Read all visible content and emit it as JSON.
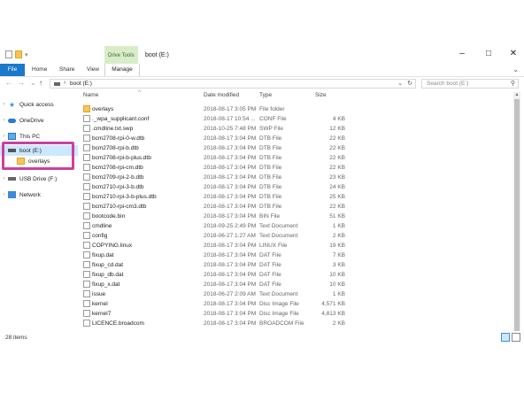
{
  "window": {
    "title": "boot (E:)",
    "context_tab_group": "Drive Tools",
    "controls": {
      "minimize": "–",
      "maximize": "□",
      "close": "✕"
    }
  },
  "ribbon": {
    "tabs": [
      {
        "label": "File"
      },
      {
        "label": "Home"
      },
      {
        "label": "Share"
      },
      {
        "label": "View"
      },
      {
        "label": "Manage"
      }
    ]
  },
  "navigation": {
    "back": "←",
    "forward": "→",
    "recent": "⌄",
    "up": "↑",
    "address_path": "boot (E:)",
    "search_placeholder": "Search boot (E:)"
  },
  "sidebar": {
    "items": [
      {
        "label": "Quick access",
        "icon": "star-icon"
      },
      {
        "label": "OneDrive",
        "icon": "cloud-icon"
      },
      {
        "label": "This PC",
        "icon": "computer-icon"
      },
      {
        "label": "boot (E:)",
        "icon": "drive-icon",
        "selected": true
      },
      {
        "label": "overlays",
        "icon": "folder-icon"
      },
      {
        "label": "USB Drive (F:)",
        "icon": "usb-drive-icon"
      },
      {
        "label": "Network",
        "icon": "network-icon"
      }
    ]
  },
  "columns": {
    "name": "Name",
    "date": "Date modified",
    "type": "Type",
    "size": "Size"
  },
  "files": [
    {
      "name": "overlays",
      "date": "2018-08-17 3:05 PM",
      "type": "File folder",
      "size": "",
      "icon": "folder"
    },
    {
      "name": "._wpa_supplicant.conf",
      "date": "2018-08-17 10:54 ...",
      "type": "CONF File",
      "size": "4 KB",
      "icon": "file"
    },
    {
      "name": ".cmdline.txt.swp",
      "date": "2018-10-25 7:48 PM",
      "type": "SWP File",
      "size": "12 KB",
      "icon": "file"
    },
    {
      "name": "bcm2708-rpi-0-w.dtb",
      "date": "2018-08-17 3:04 PM",
      "type": "DTB File",
      "size": "22 KB",
      "icon": "file"
    },
    {
      "name": "bcm2708-rpi-b.dtb",
      "date": "2018-08-17 3:04 PM",
      "type": "DTB File",
      "size": "22 KB",
      "icon": "file"
    },
    {
      "name": "bcm2708-rpi-b-plus.dtb",
      "date": "2018-08-17 3:04 PM",
      "type": "DTB File",
      "size": "22 KB",
      "icon": "file"
    },
    {
      "name": "bcm2708-rpi-cm.dtb",
      "date": "2018-08-17 3:04 PM",
      "type": "DTB File",
      "size": "22 KB",
      "icon": "file"
    },
    {
      "name": "bcm2709-rpi-2-b.dtb",
      "date": "2018-08-17 3:04 PM",
      "type": "DTB File",
      "size": "23 KB",
      "icon": "file"
    },
    {
      "name": "bcm2710-rpi-3-b.dtb",
      "date": "2018-08-17 3:04 PM",
      "type": "DTB File",
      "size": "24 KB",
      "icon": "file"
    },
    {
      "name": "bcm2710-rpi-3-b-plus.dtb",
      "date": "2018-08-17 3:04 PM",
      "type": "DTB File",
      "size": "25 KB",
      "icon": "file"
    },
    {
      "name": "bcm2710-rpi-cm3.dtb",
      "date": "2018-08-17 3:04 PM",
      "type": "DTB File",
      "size": "22 KB",
      "icon": "file"
    },
    {
      "name": "bootcode.bin",
      "date": "2018-08-17 3:04 PM",
      "type": "BIN File",
      "size": "51 KB",
      "icon": "file"
    },
    {
      "name": "cmdline",
      "date": "2018-09-25 2:49 PM",
      "type": "Text Document",
      "size": "1 KB",
      "icon": "doc"
    },
    {
      "name": "config",
      "date": "2018-06-27 1:27 AM",
      "type": "Text Document",
      "size": "2 KB",
      "icon": "doc"
    },
    {
      "name": "COPYING.linux",
      "date": "2018-08-17 3:04 PM",
      "type": "LINUX File",
      "size": "19 KB",
      "icon": "file"
    },
    {
      "name": "fixup.dat",
      "date": "2018-08-17 3:04 PM",
      "type": "DAT File",
      "size": "7 KB",
      "icon": "file"
    },
    {
      "name": "fixup_cd.dat",
      "date": "2018-08-17 3:04 PM",
      "type": "DAT File",
      "size": "3 KB",
      "icon": "file"
    },
    {
      "name": "fixup_db.dat",
      "date": "2018-08-17 3:04 PM",
      "type": "DAT File",
      "size": "10 KB",
      "icon": "file"
    },
    {
      "name": "fixup_x.dat",
      "date": "2018-08-17 3:04 PM",
      "type": "DAT File",
      "size": "10 KB",
      "icon": "file"
    },
    {
      "name": "issue",
      "date": "2018-06-27 2:09 AM",
      "type": "Text Document",
      "size": "1 KB",
      "icon": "doc"
    },
    {
      "name": "kernel",
      "date": "2018-08-17 3:04 PM",
      "type": "Disc Image File",
      "size": "4,571 KB",
      "icon": "file"
    },
    {
      "name": "kernel7",
      "date": "2018-08-17 3:04 PM",
      "type": "Disc Image File",
      "size": "4,813 KB",
      "icon": "file"
    },
    {
      "name": "LICENCE.broadcom",
      "date": "2018-08-17 3:04 PM",
      "type": "BROADCOM File",
      "size": "2 KB",
      "icon": "file"
    }
  ],
  "status": {
    "item_count": "28 items"
  },
  "colors": {
    "accent": "#1979ca",
    "context_tab": "#d8ecc9",
    "highlight_box": "#cc3fa2",
    "selection": "#cce8ff"
  }
}
